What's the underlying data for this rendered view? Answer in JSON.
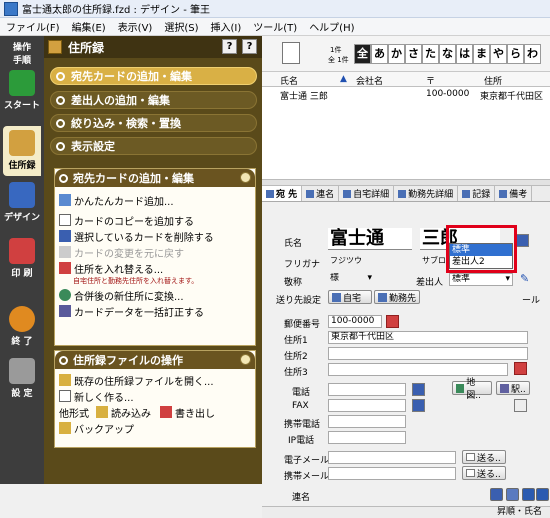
{
  "window": {
    "title": "富士通太郎の住所録.fzd : デザイン - 筆王"
  },
  "menu": [
    "ファイル(F)",
    "編集(E)",
    "表示(V)",
    "選択(S)",
    "挿入(I)",
    "ツール(T)",
    "ヘルプ(H)"
  ],
  "left_tabs": [
    {
      "label": "操作\n手順",
      "icon": "help-icon"
    },
    {
      "label": "スタート",
      "icon": "start-icon"
    },
    {
      "label": "住所録",
      "icon": "address-book-icon"
    },
    {
      "label": "デザイン",
      "icon": "design-icon"
    },
    {
      "label": "印 刷",
      "icon": "print-icon"
    },
    {
      "label": "終 了",
      "icon": "exit-icon"
    },
    {
      "label": "設 定",
      "icon": "settings-icon"
    }
  ],
  "panel": {
    "title": "住所録",
    "nav": [
      {
        "label": "宛先カードの追加・編集",
        "active": true
      },
      {
        "label": "差出人の追加・編集"
      },
      {
        "label": "絞り込み・検索・置換"
      },
      {
        "label": "表示設定"
      }
    ],
    "section1": {
      "title": "宛先カードの追加・編集",
      "items": [
        {
          "label": "かんたんカード追加...",
          "icon": "card-add-icon"
        },
        {
          "label": "カードのコピーを追加する",
          "icon": "card-copy-icon"
        },
        {
          "label": "選択しているカードを削除する",
          "icon": "card-delete-icon"
        },
        {
          "label": "カードの変更を元に戻す",
          "icon": "undo-icon",
          "disabled": true
        },
        {
          "label": "住所を入れ替える...",
          "icon": "swap-icon"
        },
        {
          "label": "合併後の新住所に変換...",
          "icon": "globe-icon"
        },
        {
          "label": "カードデータを一括訂正する",
          "icon": "batch-edit-icon"
        }
      ],
      "note": "自宅住所と勤務先住所を入れ替えます。"
    },
    "section2": {
      "title": "住所録ファイルの操作",
      "items": [
        {
          "label": "既存の住所録ファイルを開く...",
          "icon": "open-file-icon"
        },
        {
          "label": "新しく作る...",
          "icon": "new-file-icon"
        }
      ],
      "other_label": "他形式",
      "read_label": "読み込み",
      "write_label": "書き出し",
      "backup_label": "バックアップ"
    }
  },
  "toolbar": {
    "count_total": "1件",
    "count_all": "全 1件",
    "kana": [
      "全",
      "あ",
      "か",
      "さ",
      "た",
      "な",
      "は",
      "ま",
      "や",
      "ら",
      "わ"
    ]
  },
  "list": {
    "headers": [
      "氏名",
      "会社名",
      "〒",
      "住所"
    ],
    "rows": [
      {
        "name": "富士通 三郎",
        "company": "",
        "zip": "100-0000",
        "address": "東京都千代田区"
      }
    ]
  },
  "detail_tabs": [
    "宛 先",
    "連名",
    "自宅詳細",
    "勤務先詳細",
    "記録",
    "備考"
  ],
  "form": {
    "name_label": "氏名",
    "sei": "富士通",
    "mei": "三郎",
    "furigana_label": "フリガナ",
    "sei_kana": "フジツウ",
    "mei_kana": "サブロウ",
    "honorific_label": "敬称",
    "honorific": "様",
    "sender_label": "差出人",
    "sender": "標準",
    "sender_options": [
      "標準",
      "差出人2"
    ],
    "send_label": "送り先設定",
    "home_label": "自宅",
    "work_label": "勤務先",
    "zip_label": "郵便番号",
    "zip": "100-0000",
    "addr1_label": "住所1",
    "addr1": "東京都千代田区",
    "addr2_label": "住所2",
    "addr3_label": "住所3",
    "tel_label": "電話",
    "fax_label": "FAX",
    "mobile_label": "携帯電話",
    "ip_label": "IP電話",
    "map_label": "地図..",
    "station_label": "駅..",
    "email_label": "電子メール",
    "mobile_mail_label": "携帯メール",
    "send_mail_label": "送る..",
    "renmei_label": "連名",
    "status": "昇順・氏名"
  },
  "colors": {
    "panel_bg": "#5a4a1a",
    "accent_gold": "#d9b045",
    "highlight_red": "#e0001a"
  }
}
